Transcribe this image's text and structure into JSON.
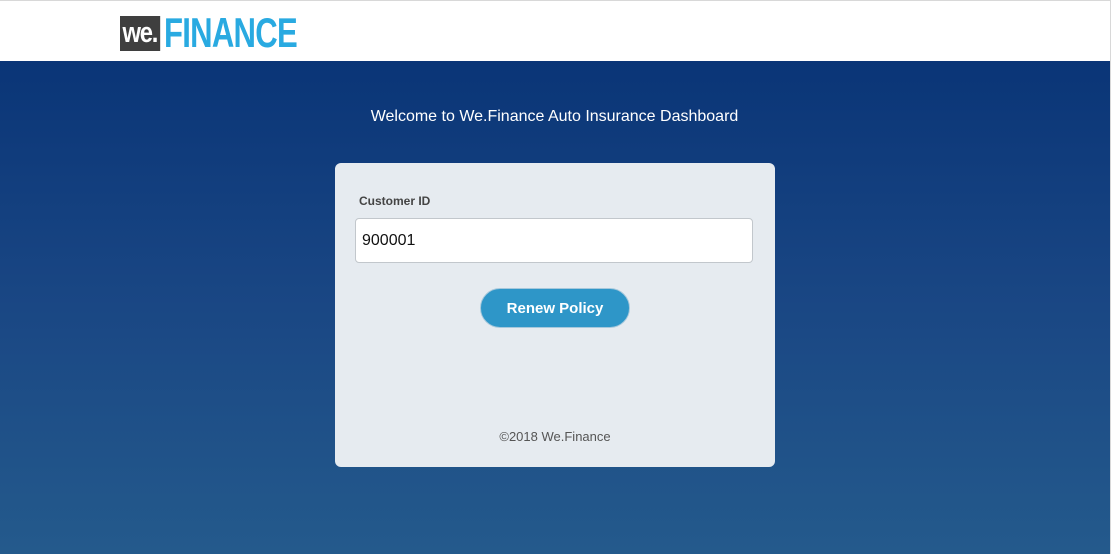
{
  "header": {
    "logo": {
      "part1": "we.",
      "part2": "FINANCE"
    }
  },
  "main": {
    "welcome": "Welcome to We.Finance Auto Insurance Dashboard",
    "form": {
      "customer_id_label": "Customer ID",
      "customer_id_value": "900001",
      "renew_button": "Renew Policy"
    },
    "footer": "©2018 We.Finance"
  },
  "colors": {
    "brand_blue": "#29aae1",
    "logo_dark": "#3f3f3f",
    "background_top": "#0a3577",
    "background_bottom": "#245a8c",
    "button": "#2e96c8",
    "card": "#e6ebf0"
  }
}
